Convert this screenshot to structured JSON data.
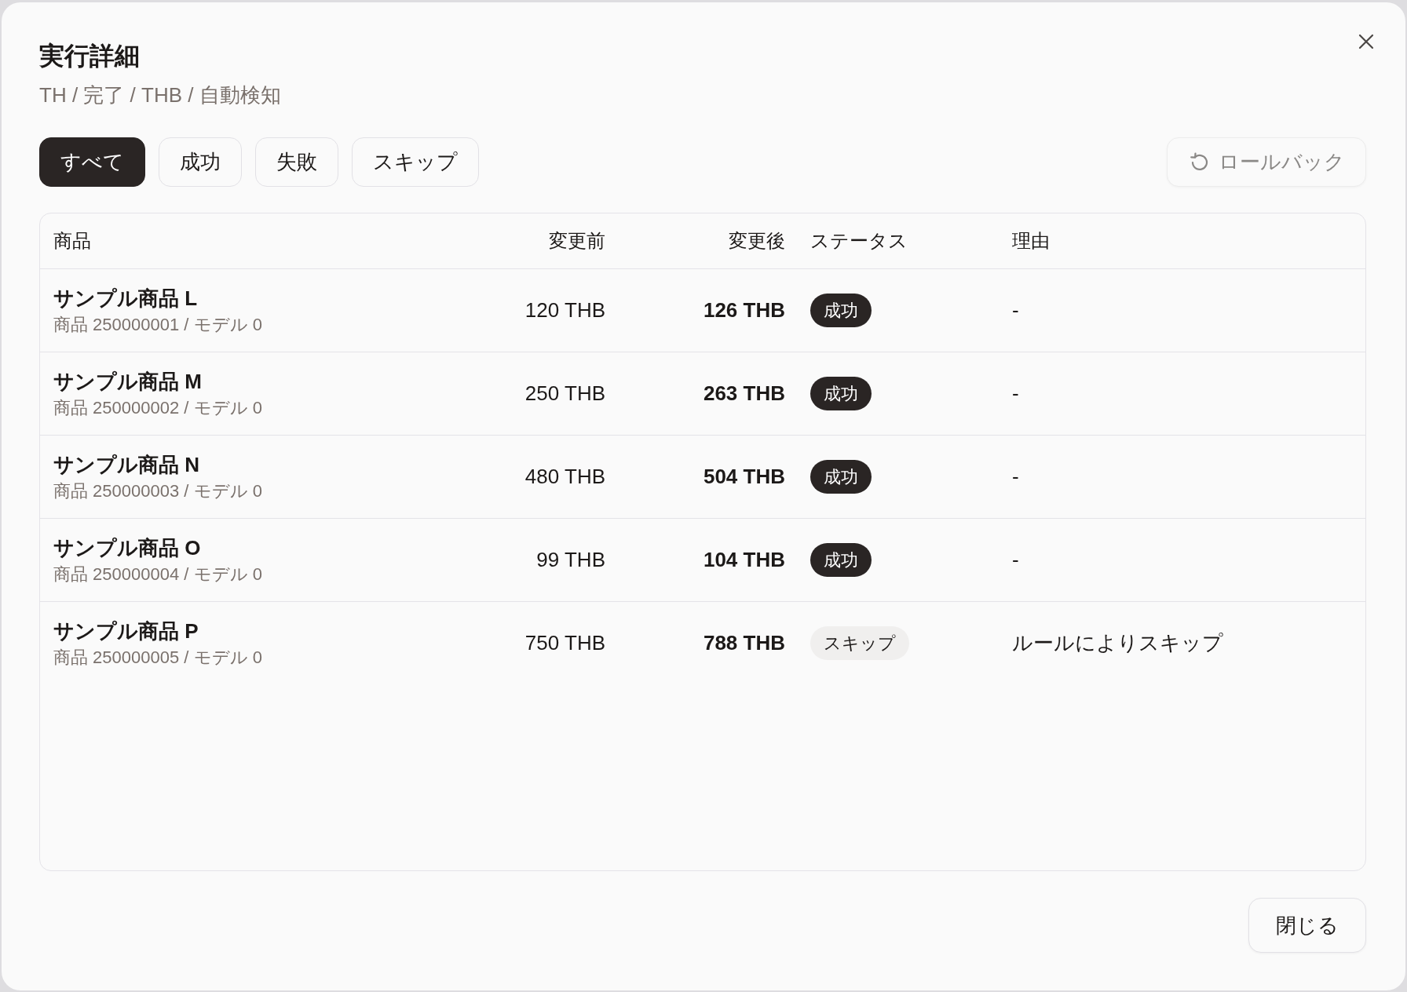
{
  "dialog": {
    "title": "実行詳細",
    "subtitle": "TH / 完了 / THB / 自動検知"
  },
  "filters": [
    {
      "label": "すべて",
      "selected": true
    },
    {
      "label": "成功",
      "selected": false
    },
    {
      "label": "失敗",
      "selected": false
    },
    {
      "label": "スキップ",
      "selected": false
    }
  ],
  "rollback_button": {
    "label": "ロールバック",
    "disabled": true
  },
  "table": {
    "columns": [
      "商品",
      "変更前",
      "変更後",
      "ステータス",
      "理由"
    ],
    "rows": [
      {
        "name": "サンプル商品 L",
        "detail": "商品 250000001 / モデル 0",
        "before": "120 THB",
        "after": "126 THB",
        "status": {
          "label": "成功",
          "kind": "success"
        },
        "reason": "-"
      },
      {
        "name": "サンプル商品 M",
        "detail": "商品 250000002 / モデル 0",
        "before": "250 THB",
        "after": "263 THB",
        "status": {
          "label": "成功",
          "kind": "success"
        },
        "reason": "-"
      },
      {
        "name": "サンプル商品 N",
        "detail": "商品 250000003 / モデル 0",
        "before": "480 THB",
        "after": "504 THB",
        "status": {
          "label": "成功",
          "kind": "success"
        },
        "reason": "-"
      },
      {
        "name": "サンプル商品 O",
        "detail": "商品 250000004 / モデル 0",
        "before": "99 THB",
        "after": "104 THB",
        "status": {
          "label": "成功",
          "kind": "success"
        },
        "reason": "-"
      },
      {
        "name": "サンプル商品 P",
        "detail": "商品 250000005 / モデル 0",
        "before": "750 THB",
        "after": "788 THB",
        "status": {
          "label": "スキップ",
          "kind": "skipped"
        },
        "reason": "ルールによりスキップ"
      }
    ]
  },
  "footer": {
    "close_button": "閉じる"
  }
}
